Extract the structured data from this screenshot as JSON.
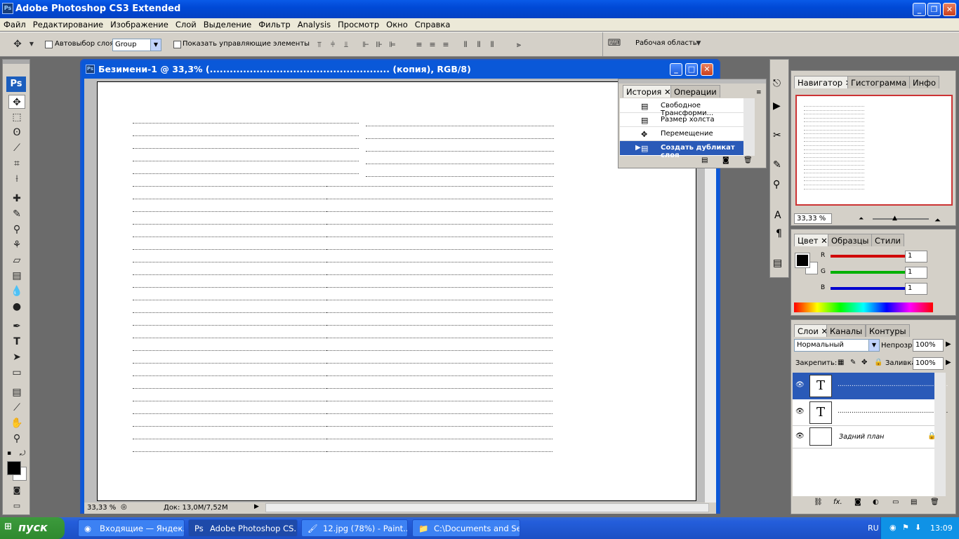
{
  "app": {
    "title": "Adobe Photoshop CS3 Extended",
    "icon": "ps-icon"
  },
  "menu": [
    "Файл",
    "Редактирование",
    "Изображение",
    "Слой",
    "Выделение",
    "Фильтр",
    "Analysis",
    "Просмотр",
    "Окно",
    "Справка"
  ],
  "options": {
    "autoselect_label": "Автовыбор слоя",
    "autoselect_value": "Group",
    "show_transform_label": "Показать управляющие элементы",
    "workspace_label": "Рабочая область"
  },
  "document": {
    "title": "Безимени-1 @ 33,3% (...................................................... (копия), RGB/8)",
    "zoom": "33,33 %",
    "doc_info": "Док: 13,0M/7,52M"
  },
  "history": {
    "tabs": [
      "История",
      "Операции"
    ],
    "items": [
      "Свободное Трансформи...",
      "Размер холста",
      "Перемещение",
      "Создать дубликат слоя"
    ],
    "active_index": 3
  },
  "navigator": {
    "tabs": [
      "Навигатор",
      "Гистограмма",
      "Инфо"
    ],
    "zoom": "33,33 %"
  },
  "color": {
    "tabs": [
      "Цвет",
      "Образцы",
      "Стили"
    ],
    "channels": [
      {
        "label": "R",
        "value": "1",
        "color": "#d00000"
      },
      {
        "label": "G",
        "value": "1",
        "color": "#00b000"
      },
      {
        "label": "B",
        "value": "1",
        "color": "#0000d0"
      }
    ]
  },
  "layers": {
    "tabs": [
      "Слои",
      "Каналы",
      "Контуры"
    ],
    "blend_mode": "Нормальный",
    "opacity_label": "Непрозр.:",
    "opacity": "100%",
    "lock_label": "Закрепить:",
    "fill_label": "Заливка:",
    "fill": "100%",
    "items": [
      {
        "type": "text",
        "name": ".......................................................",
        "selected": true
      },
      {
        "type": "text",
        "name": "......................................................."
      },
      {
        "type": "image",
        "name": "Задний план",
        "locked": true
      }
    ]
  },
  "taskbar": {
    "start": "пуск",
    "tasks": [
      "Входящие — Яндек...",
      "Adobe Photoshop CS...",
      "12.jpg (78%) - Paint....",
      "C:\\Documents and Se..."
    ],
    "active_task": 1,
    "lang": "RU",
    "clock": "13:09"
  }
}
